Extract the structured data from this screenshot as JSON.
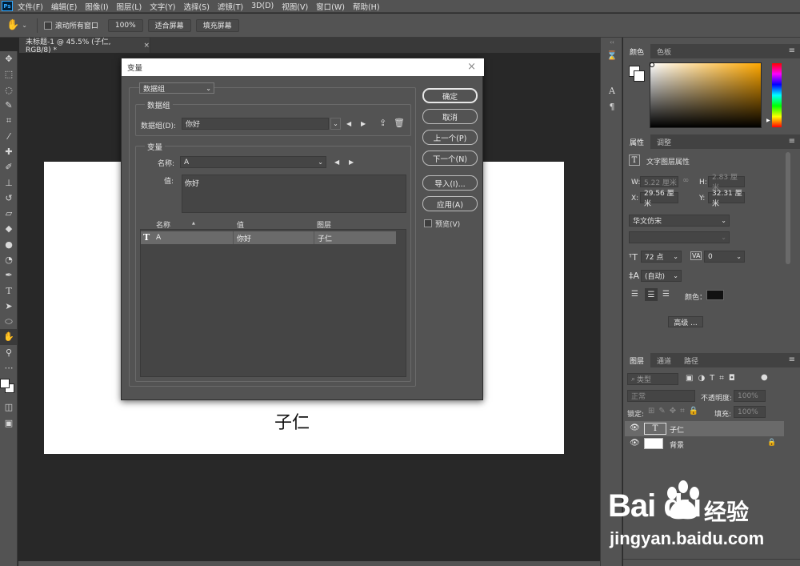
{
  "menubar": {
    "logo": "Ps",
    "items": [
      "文件(F)",
      "编辑(E)",
      "图像(I)",
      "图层(L)",
      "文字(Y)",
      "选择(S)",
      "滤镜(T)",
      "3D(D)",
      "视图(V)",
      "窗口(W)",
      "帮助(H)"
    ]
  },
  "optionsbar": {
    "scroll_all": "滚动所有窗口",
    "zoom": "100%",
    "fit_screen": "适合屏幕",
    "fill_screen": "填充屏幕"
  },
  "document": {
    "tab_title": "未标题-1 @ 45.5% (子仁, RGB/8) *",
    "tab_close": "×",
    "canvas_text": "子仁"
  },
  "panels": {
    "color_tabs": [
      "颜色",
      "色板"
    ],
    "props_tabs": [
      "属性",
      "调整"
    ],
    "props_title": "文字图层属性",
    "w_label": "W:",
    "w_value": "5.22 厘米",
    "h_label": "H:",
    "h_value": "2.83 厘米",
    "x_label": "X:",
    "x_value": "29.56 厘米",
    "y_label": "Y:",
    "y_value": "32.31 厘米",
    "font_family": "华文仿宋",
    "font_size": "72 点",
    "tracking": "0",
    "leading": "(自动)",
    "color_label": "颜色：",
    "advanced": "高级 ...",
    "layers_tabs": [
      "图层",
      "通道",
      "路径"
    ],
    "layer_filter": "类型",
    "blend_mode": "正常",
    "opacity_label": "不透明度:",
    "opacity_value": "100%",
    "lock_label": "锁定:",
    "fill_label": "填充:",
    "fill_value": "100%",
    "layers": [
      {
        "name": "子仁",
        "type": "text"
      },
      {
        "name": "背景",
        "type": "background"
      }
    ]
  },
  "dialog": {
    "title": "变量",
    "close": "×",
    "mode_select": "数据组",
    "dataset_group_title": "数据组",
    "dataset_label": "数据组(D):",
    "dataset_value": "你好",
    "variable_group_title": "变量",
    "name_label": "名称:",
    "name_value": "A",
    "value_label": "值:",
    "value_value": "你好",
    "table_headers": [
      "名称",
      "值",
      "图层"
    ],
    "sort_marker": "▲",
    "rows": [
      {
        "icon": "T",
        "name": "A",
        "value": "你好",
        "layer": "子仁"
      }
    ],
    "buttons": {
      "ok": "确定",
      "cancel": "取消",
      "prev": "上一个(P)",
      "next": "下一个(N)",
      "import": "导入(I)...",
      "apply": "应用(A)"
    },
    "preview": "预览(V)"
  },
  "watermark": {
    "brand": "Bai  du",
    "brand_cn": "经验",
    "url": "jingyan.baidu.com"
  },
  "colors": {
    "ui_bg": "#535353",
    "canvas_bg": "#282828",
    "hue_accent": "#ffa800"
  }
}
